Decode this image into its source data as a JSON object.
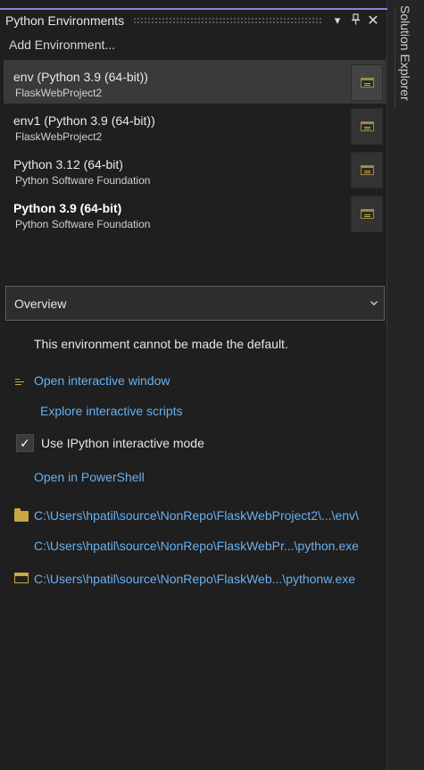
{
  "panel": {
    "title": "Python Environments",
    "add_environment": "Add Environment..."
  },
  "environments": [
    {
      "name": "env (Python 3.9 (64-bit))",
      "source": "FlaskWebProject2",
      "selected": true,
      "bold": false
    },
    {
      "name": "env1 (Python 3.9 (64-bit))",
      "source": "FlaskWebProject2",
      "selected": false,
      "bold": false
    },
    {
      "name": "Python 3.12 (64-bit)",
      "source": "Python Software Foundation",
      "selected": false,
      "bold": false
    },
    {
      "name": "Python 3.9 (64-bit)",
      "source": "Python Software Foundation",
      "selected": false,
      "bold": true
    }
  ],
  "view_select": {
    "value": "Overview"
  },
  "overview": {
    "default_note": "This environment cannot be made the default.",
    "open_interactive": "Open interactive window",
    "explore_scripts": "Explore interactive scripts",
    "ipython_label": "Use IPython interactive mode",
    "ipython_checked": true,
    "open_powershell": "Open in PowerShell",
    "env_path": "C:\\Users\\hpatil\\source\\NonRepo\\FlaskWebProject2\\...\\env\\",
    "python_exe": "C:\\Users\\hpatil\\source\\NonRepo\\FlaskWebPr...\\python.exe",
    "pythonw_exe": "C:\\Users\\hpatil\\source\\NonRepo\\FlaskWeb...\\pythonw.exe"
  },
  "side_tab": {
    "label": "Solution Explorer"
  },
  "icons": {
    "dropdown": "chevron-down-icon",
    "pin": "pin-icon",
    "close": "close-icon",
    "window_menu": "window-menu-icon",
    "check": "checkmark-icon",
    "folder": "folder-icon",
    "window": "window-icon"
  },
  "colors": {
    "accent_line": "#8f80d6",
    "link": "#6ab0ef",
    "icon_gold": "#c9a743",
    "background": "#1f1f1f"
  }
}
